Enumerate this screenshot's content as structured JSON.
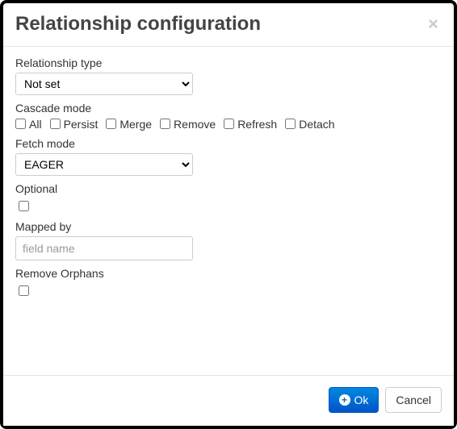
{
  "dialog": {
    "title": "Relationship configuration"
  },
  "relType": {
    "label": "Relationship type",
    "value": "Not set"
  },
  "cascade": {
    "label": "Cascade mode",
    "options": {
      "all": {
        "label": "All",
        "checked": false
      },
      "persist": {
        "label": "Persist",
        "checked": false
      },
      "merge": {
        "label": "Merge",
        "checked": false
      },
      "remove": {
        "label": "Remove",
        "checked": false
      },
      "refresh": {
        "label": "Refresh",
        "checked": false
      },
      "detach": {
        "label": "Detach",
        "checked": false
      }
    }
  },
  "fetch": {
    "label": "Fetch mode",
    "value": "EAGER"
  },
  "optional": {
    "label": "Optional",
    "checked": false
  },
  "mappedBy": {
    "label": "Mapped by",
    "placeholder": "field name",
    "value": ""
  },
  "removeOrphans": {
    "label": "Remove Orphans",
    "checked": false
  },
  "buttons": {
    "ok": "Ok",
    "cancel": "Cancel"
  }
}
